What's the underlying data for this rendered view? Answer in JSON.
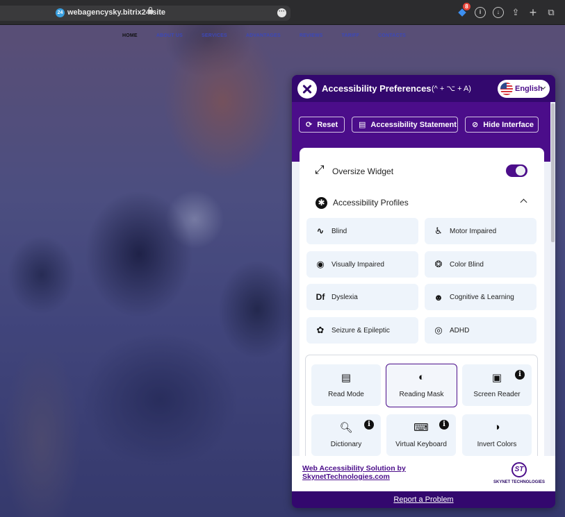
{
  "browser": {
    "favicon_text": "24",
    "url": "webagencysky.bitrix24.site",
    "notification_badge": "8"
  },
  "site": {
    "nav": [
      {
        "label": "HOME",
        "active": true
      },
      {
        "label": "ABOUT US",
        "active": false
      },
      {
        "label": "SERVICES",
        "active": false
      },
      {
        "label": "ADVANTAGES",
        "active": false
      },
      {
        "label": "REVIEWS",
        "active": false
      },
      {
        "label": "TARIFF",
        "active": false
      },
      {
        "label": "CONTACTS",
        "active": false
      }
    ]
  },
  "widget": {
    "title": "Accessibility Preferences",
    "shortcut": "(^ + ⌥ + A)",
    "language": "English",
    "actions": {
      "reset": "Reset",
      "statement": "Accessibility Statement",
      "hide": "Hide Interface"
    },
    "oversize_widget": {
      "label": "Oversize Widget",
      "enabled": true
    },
    "profiles_section": {
      "label": "Accessibility Profiles",
      "expanded": true
    },
    "profiles": [
      {
        "label": "Blind",
        "icon": "sound-wave-icon"
      },
      {
        "label": "Motor Impaired",
        "icon": "wheelchair-icon"
      },
      {
        "label": "Visually Impaired",
        "icon": "eye-icon"
      },
      {
        "label": "Color Blind",
        "icon": "color-dots-icon"
      },
      {
        "label": "Dyslexia",
        "icon": "df-letters-icon"
      },
      {
        "label": "Cognitive & Learning",
        "icon": "brain-head-icon"
      },
      {
        "label": "Seizure & Epileptic",
        "icon": "brain-icon"
      },
      {
        "label": "ADHD",
        "icon": "target-icon"
      }
    ],
    "tools": [
      {
        "label": "Read Mode",
        "icon": "document-icon",
        "selected": false,
        "info": false
      },
      {
        "label": "Reading Mask",
        "icon": "mask-icon",
        "selected": true,
        "info": false
      },
      {
        "label": "Screen Reader",
        "icon": "screen-speaker-icon",
        "selected": false,
        "info": true
      },
      {
        "label": "Dictionary",
        "icon": "magnifier-a-icon",
        "selected": false,
        "info": true
      },
      {
        "label": "Virtual Keyboard",
        "icon": "keyboard-icon",
        "selected": false,
        "info": true
      },
      {
        "label": "Invert Colors",
        "icon": "contrast-drop-icon",
        "selected": false,
        "info": false
      }
    ],
    "footer": {
      "link_line1": "Web Accessibility Solution by",
      "link_line2": "SkynetTechnologies.com",
      "logo_mark": "ST",
      "logo_text": "SKYNET TECHNOLOGIES",
      "report": "Report a Problem"
    },
    "colors": {
      "primary": "#4b0d8a",
      "header": "#33086e",
      "tile_bg": "#eef4fb"
    }
  }
}
